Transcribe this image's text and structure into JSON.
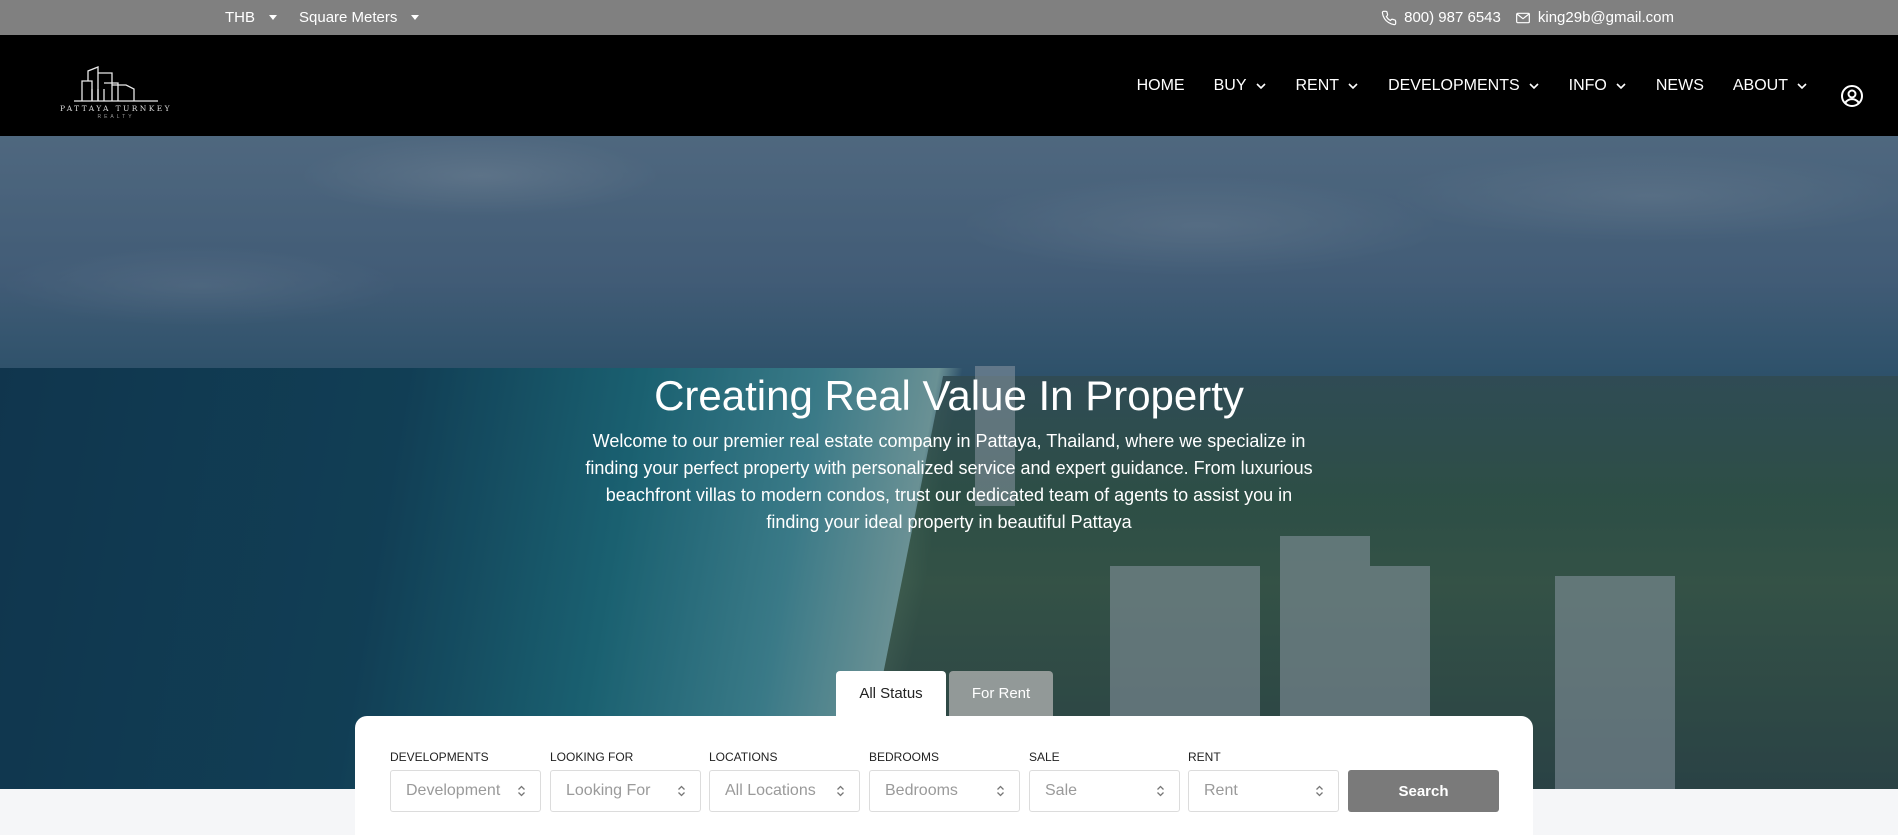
{
  "topbar": {
    "currency": "THB",
    "area_unit": "Square Meters",
    "phone": "800) 987 6543",
    "email": "king29b@gmail.com"
  },
  "logo": {
    "brand": "PATTAYA TURNKEY",
    "sub": "REALTY"
  },
  "nav": {
    "items": [
      {
        "label": "HOME",
        "has_dropdown": false
      },
      {
        "label": "BUY",
        "has_dropdown": true
      },
      {
        "label": "RENT",
        "has_dropdown": true
      },
      {
        "label": "DEVELOPMENTS",
        "has_dropdown": true
      },
      {
        "label": "INFO",
        "has_dropdown": true
      },
      {
        "label": "NEWS",
        "has_dropdown": false
      },
      {
        "label": "ABOUT",
        "has_dropdown": true
      }
    ],
    "user_icon": "user-circle-icon"
  },
  "hero": {
    "title": "Creating Real Value In Property",
    "text": "Welcome to our premier real estate company in Pattaya, Thailand, where we specialize in finding your perfect property with personalized service and expert guidance. From luxurious beachfront villas to modern condos, trust our dedicated team of agents to assist you in finding your ideal property in beautiful Pattaya"
  },
  "search": {
    "tabs": [
      {
        "label": "All Status",
        "active": true
      },
      {
        "label": "For Rent",
        "active": false
      }
    ],
    "fields": [
      {
        "label": "DEVELOPMENTS",
        "value": "Development"
      },
      {
        "label": "LOOKING FOR",
        "value": "Looking For"
      },
      {
        "label": "LOCATIONS",
        "value": "All Locations"
      },
      {
        "label": "BEDROOMS",
        "value": "Bedrooms"
      },
      {
        "label": "SALE",
        "value": "Sale"
      },
      {
        "label": "RENT",
        "value": "Rent"
      }
    ],
    "button_label": "Search"
  },
  "colors": {
    "topbar_bg": "#808080",
    "header_bg": "#000000",
    "search_button": "#7a7a7a"
  }
}
